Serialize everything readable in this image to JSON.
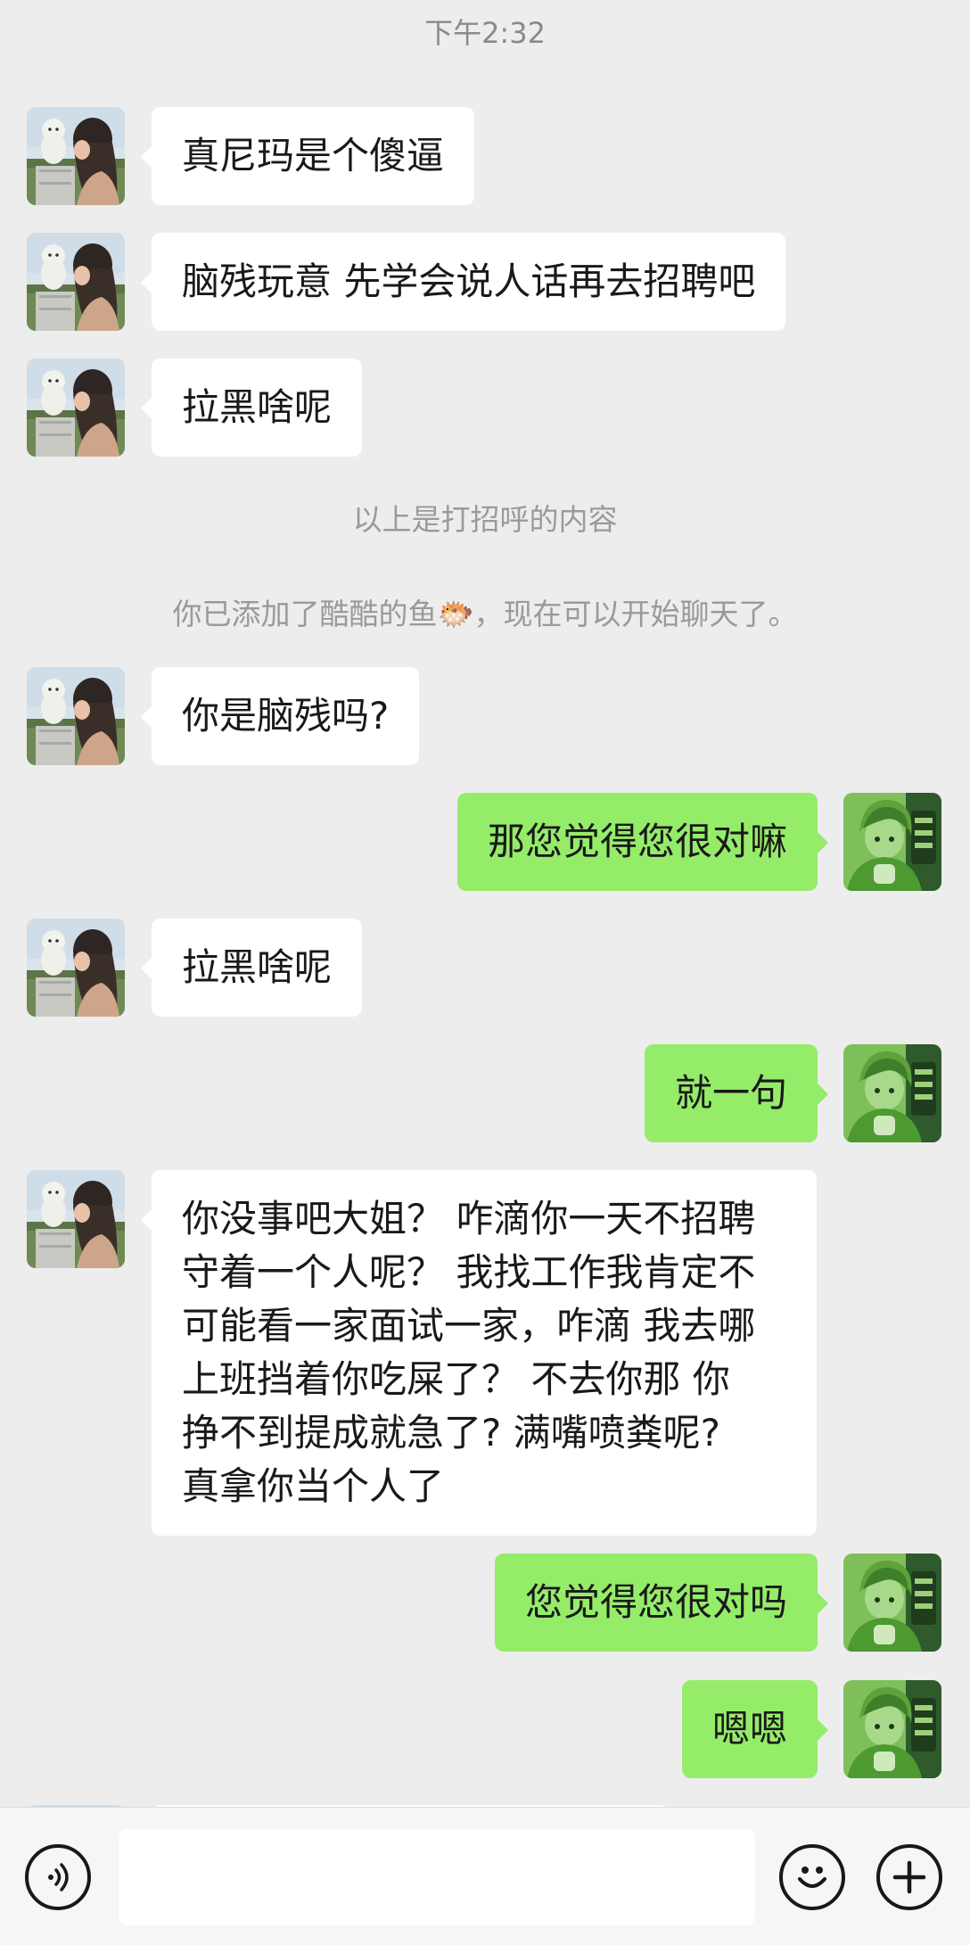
{
  "time": "下午2:32",
  "messages": [
    {
      "side": "in",
      "text": "真尼玛是个傻逼"
    },
    {
      "side": "in",
      "text": "脑残玩意 先学会说人话再去招聘吧"
    },
    {
      "side": "in",
      "text": "拉黑啥呢"
    },
    {
      "side": "in",
      "text": "你是脑残吗?"
    },
    {
      "side": "out",
      "text": "那您觉得您很对嘛"
    },
    {
      "side": "in",
      "text": "拉黑啥呢"
    },
    {
      "side": "out",
      "text": "就一句"
    },
    {
      "side": "in",
      "lines": [
        "你没事吧大姐？ 咋滴你一天不招聘",
        "守着一个人呢？ 我找工作我肯定不",
        "可能看一家面试一家，咋滴 我去哪",
        "上班挡着你吃屎了？ 不去你那 你",
        "挣不到提成就急了? 满嘴喷粪呢?",
        "真拿你当个人了"
      ]
    },
    {
      "side": "out",
      "text": "您觉得您很对吗"
    },
    {
      "side": "out",
      "text": "嗯嗯"
    }
  ],
  "system": {
    "greeting_note": "以上是打招呼的内容",
    "added_note": "你已添加了酷酷的鱼🐡，现在可以开始聊天了。"
  },
  "input_bar": {
    "voice_icon": "voice-icon",
    "emoji_icon": "emoji-icon",
    "plus_icon": "plus-icon",
    "placeholder": ""
  },
  "colors": {
    "background": "#ededed",
    "incoming_bubble": "#ffffff",
    "outgoing_bubble": "#95ec69",
    "system_text": "#9a9a9a"
  }
}
